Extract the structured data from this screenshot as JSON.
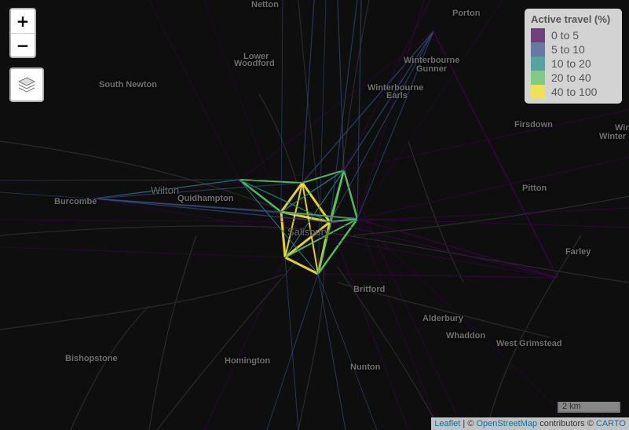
{
  "places": [
    {
      "name": "Netton"
    },
    {
      "name": "Porton"
    },
    {
      "name": "Lower"
    },
    {
      "name": "Woodford"
    },
    {
      "name": "Winterbourne"
    },
    {
      "name": "Gunner"
    },
    {
      "name": "South Newton"
    },
    {
      "name": "Winterbourne"
    },
    {
      "name": "Earls"
    },
    {
      "name": "Firsdown"
    },
    {
      "name": "Wilton"
    },
    {
      "name": "Burcombe"
    },
    {
      "name": "Quidhampton"
    },
    {
      "name": "Pitton"
    },
    {
      "name": "Salisbury"
    },
    {
      "name": "Farley"
    },
    {
      "name": "Britford"
    },
    {
      "name": "Alderbury"
    },
    {
      "name": "Whaddon"
    },
    {
      "name": "West Grimstead"
    },
    {
      "name": "Bishopstone"
    },
    {
      "name": "Homington"
    },
    {
      "name": "Nunton"
    },
    {
      "name": "Winter"
    },
    {
      "name": "Wins"
    }
  ],
  "zoom": {
    "in_label": "+",
    "out_label": "−"
  },
  "legend": {
    "title": "Active travel (%)",
    "items": [
      {
        "label": "0 to 5",
        "color": "#440154"
      },
      {
        "label": "5 to 10",
        "color": "#3b528b"
      },
      {
        "label": "10 to 20",
        "color": "#21908d"
      },
      {
        "label": "20 to 40",
        "color": "#5dc963"
      },
      {
        "label": "40 to 100",
        "color": "#fde725"
      }
    ]
  },
  "scale": {
    "label": "2 km"
  },
  "attribution": {
    "leaflet": "Leaflet",
    "sep": " | © ",
    "osm": "OpenStreetMap",
    "mid": " contributors © ",
    "carto": "CARTO"
  }
}
